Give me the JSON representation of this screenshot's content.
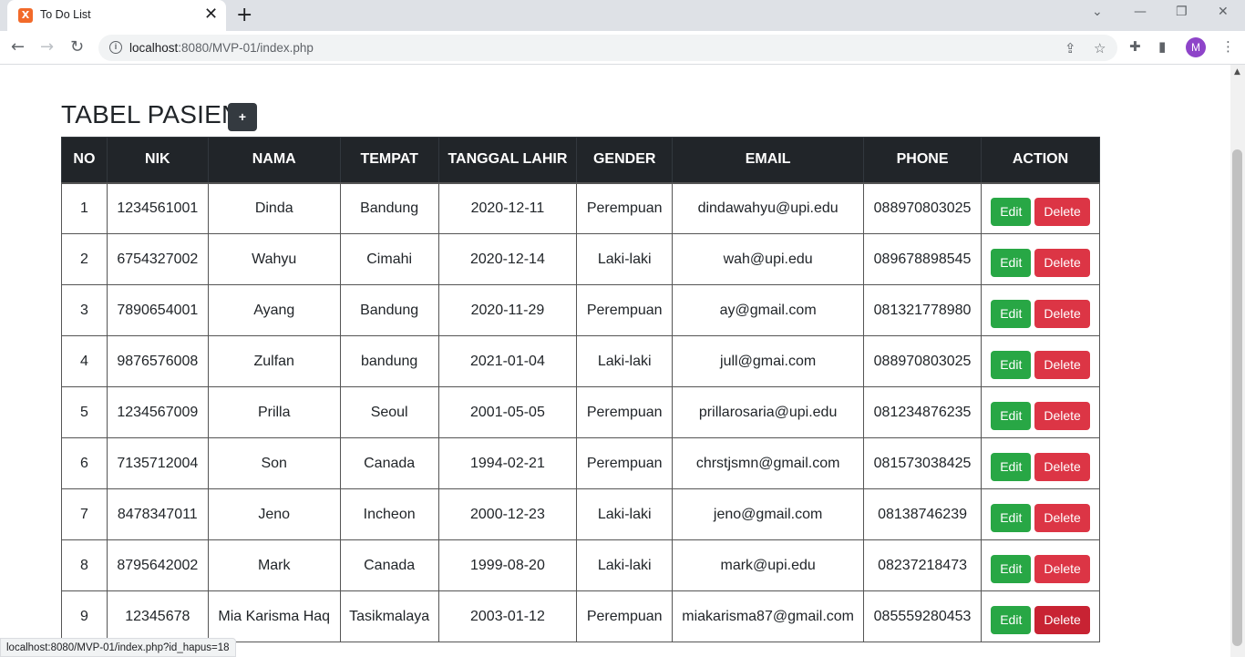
{
  "browser": {
    "tab_title": "To Do List",
    "favicon_letter": "X",
    "close_glyph": "✕",
    "new_tab_glyph": "+",
    "url_host": "localhost",
    "url_rest": ":8080/MVP-01/index.php",
    "avatar_letter": "M",
    "status_url": "localhost:8080/MVP-01/index.php?id_hapus=18"
  },
  "page": {
    "title": "TABEL PASIEN",
    "add_label": "+",
    "edit_label": "Edit",
    "delete_label": "Delete"
  },
  "table": {
    "headers": [
      "NO",
      "NIK",
      "NAMA",
      "TEMPAT",
      "TANGGAL LAHIR",
      "GENDER",
      "EMAIL",
      "PHONE",
      "ACTION"
    ],
    "rows": [
      [
        "1",
        "1234561001",
        "Dinda",
        "Bandung",
        "2020-12-11",
        "Perempuan",
        "dindawahyu@upi.edu",
        "088970803025"
      ],
      [
        "2",
        "6754327002",
        "Wahyu",
        "Cimahi",
        "2020-12-14",
        "Laki-laki",
        "wah@upi.edu",
        "089678898545"
      ],
      [
        "3",
        "7890654001",
        "Ayang",
        "Bandung",
        "2020-11-29",
        "Perempuan",
        "ay@gmail.com",
        "081321778980"
      ],
      [
        "4",
        "9876576008",
        "Zulfan",
        "bandung",
        "2021-01-04",
        "Laki-laki",
        "jull@gmai.com",
        "088970803025"
      ],
      [
        "5",
        "1234567009",
        "Prilla",
        "Seoul",
        "2001-05-05",
        "Perempuan",
        "prillarosaria@upi.edu",
        "081234876235"
      ],
      [
        "6",
        "7135712004",
        "Son",
        "Canada",
        "1994-02-21",
        "Perempuan",
        "chrstjsmn@gmail.com",
        "081573038425"
      ],
      [
        "7",
        "8478347011",
        "Jeno",
        "Incheon",
        "2000-12-23",
        "Laki-laki",
        "jeno@gmail.com",
        "08138746239"
      ],
      [
        "8",
        "8795642002",
        "Mark",
        "Canada",
        "1999-08-20",
        "Laki-laki",
        "mark@upi.edu",
        "08237218473"
      ],
      [
        "9",
        "12345678",
        "Mia Karisma Haq",
        "Tasikmalaya",
        "2003-01-12",
        "Perempuan",
        "miakarisma87@gmail.com",
        "085559280453"
      ]
    ]
  }
}
